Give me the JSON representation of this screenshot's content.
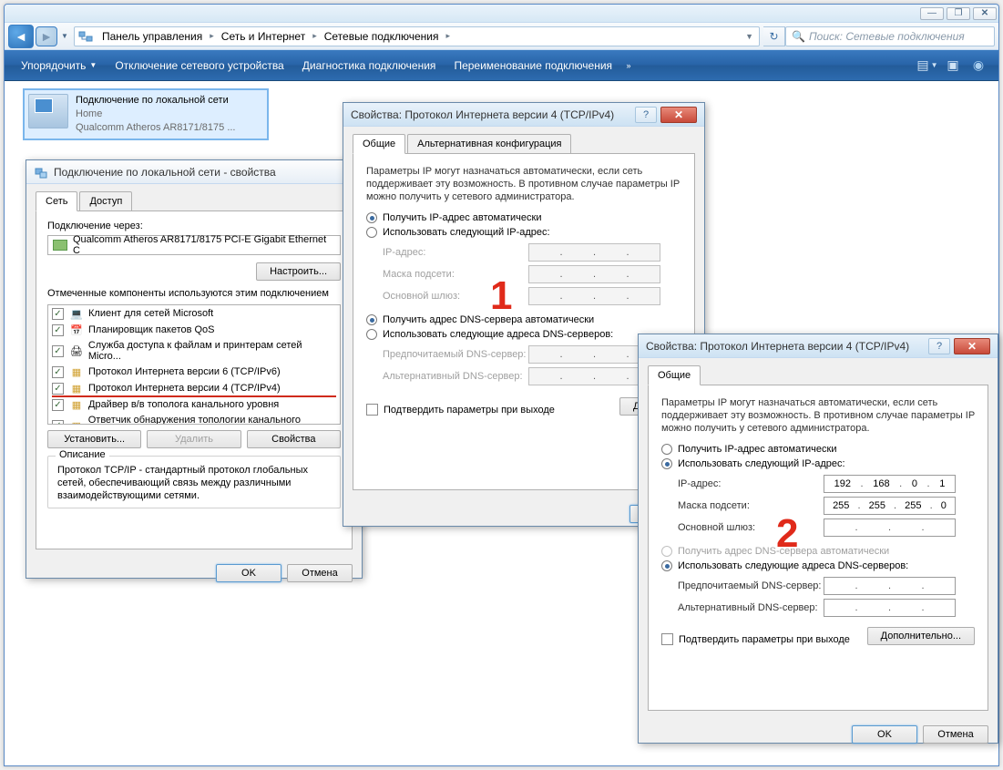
{
  "explorer": {
    "breadcrumbs": [
      "Панель управления",
      "Сеть и Интернет",
      "Сетевые подключения"
    ],
    "search_placeholder": "Поиск: Сетевые подключения",
    "toolbar": {
      "organize": "Упорядочить",
      "disable": "Отключение сетевого устройства",
      "diagnose": "Диагностика подключения",
      "rename": "Переименование подключения"
    },
    "connection": {
      "name": "Подключение по локальной сети",
      "status": "Home",
      "adapter": "Qualcomm Atheros AR8171/8175 ..."
    }
  },
  "props_dialog": {
    "title": "Подключение по локальной сети - свойства",
    "tab_network": "Сеть",
    "tab_access": "Доступ",
    "connect_using": "Подключение через:",
    "adapter": "Qualcomm Atheros AR8171/8175 PCI-E Gigabit Ethernet C",
    "configure": "Настроить...",
    "components_label": "Отмеченные компоненты используются этим подключением",
    "components": [
      "Клиент для сетей Microsoft",
      "Планировщик пакетов QoS",
      "Служба доступа к файлам и принтерам сетей Micro...",
      "Протокол Интернета версии 6 (TCP/IPv6)",
      "Протокол Интернета версии 4 (TCP/IPv4)",
      "Драйвер в/в тополога канального уровня",
      "Ответчик обнаружения топологии канального уровн..."
    ],
    "install": "Установить...",
    "uninstall": "Удалить",
    "properties": "Свойства",
    "desc_title": "Описание",
    "desc": "Протокол TCP/IP - стандартный протокол глобальных сетей, обеспечивающий связь между различными взаимодействующими сетями.",
    "ok": "OK",
    "cancel": "Отмена"
  },
  "ip_dialog": {
    "title": "Свойства: Протокол Интернета версии 4 (TCP/IPv4)",
    "tab_general": "Общие",
    "tab_alt": "Альтернативная конфигурация",
    "info": "Параметры IP могут назначаться автоматически, если сеть поддерживает эту возможность. В противном случае параметры IP можно получить у сетевого администратора.",
    "auto_ip": "Получить IP-адрес автоматически",
    "manual_ip": "Использовать следующий IP-адрес:",
    "ip_label": "IP-адрес:",
    "mask_label": "Маска подсети:",
    "gateway_label": "Основной шлюз:",
    "auto_dns": "Получить адрес DNS-сервера автоматически",
    "manual_dns": "Использовать следующие адреса DNS-серверов:",
    "pref_dns": "Предпочитаемый DNS-сервер:",
    "alt_dns": "Альтернативный DNS-сервер:",
    "validate": "Подтвердить параметры при выходе",
    "advanced": "Дополнительно...",
    "ok": "OK",
    "cancel": "Отмена"
  },
  "ip_values": {
    "ip": [
      "192",
      "168",
      "0",
      "1"
    ],
    "mask": [
      "255",
      "255",
      "255",
      "0"
    ]
  },
  "annotations": {
    "num1": "1",
    "num2": "2"
  }
}
